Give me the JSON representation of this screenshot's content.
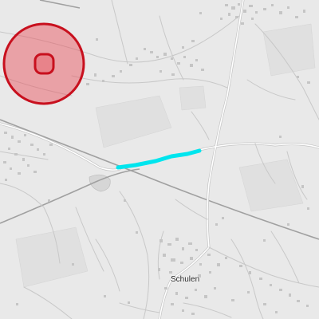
{
  "map": {
    "place_labels": [
      {
        "name": "Schulen"
      }
    ],
    "colors": {
      "background": "#e9e9e9",
      "field": "#dedede",
      "road": "#ffffff",
      "road_casing": "#c2c2c2",
      "railway": "#9a9a9a",
      "building": "#c4c4c4",
      "highlight_route": "#00e5ee",
      "marker_fill": "#e84a55",
      "marker_stroke": "#c8101e"
    },
    "icons": {
      "location_marker": "target-circle-icon"
    }
  }
}
